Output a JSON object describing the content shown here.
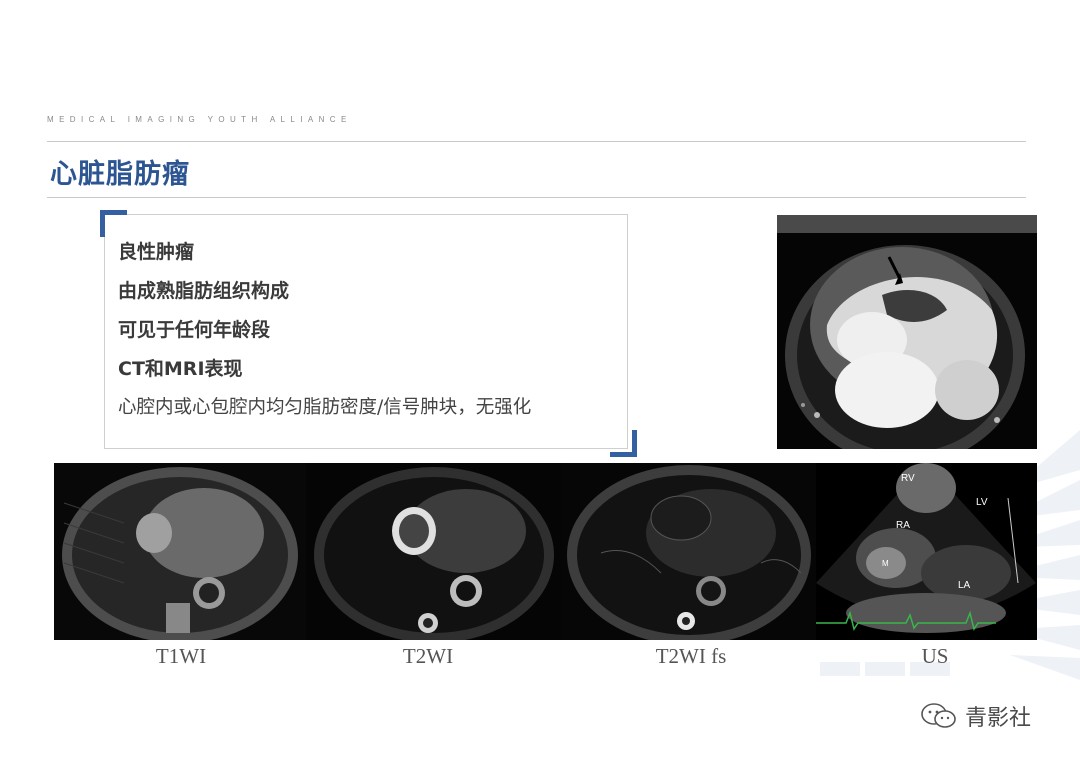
{
  "header": {
    "org_line": "MEDICAL IMAGING YOUTH ALLIANCE",
    "title": "心脏脂肪瘤"
  },
  "bullets": [
    {
      "text": "良性肿瘤",
      "bold": true
    },
    {
      "text": "由成熟脂肪组织构成",
      "bold": true
    },
    {
      "text": "可见于任何年龄段",
      "bold": true
    },
    {
      "text": "CT和MRI表现",
      "bold": true
    },
    {
      "text": "心腔内或心包腔内均匀脂肪密度/信号肿块，无强化",
      "bold": false
    }
  ],
  "images": {
    "ct": {
      "name": "ct-image"
    },
    "us_labels": {
      "rv": "RV",
      "lv": "LV",
      "ra": "RA",
      "la": "LA",
      "m": "M"
    }
  },
  "captions": [
    "T1WI",
    "T2WI",
    "T2WI fs",
    "US"
  ],
  "watermark": {
    "text": "青影社"
  },
  "colors": {
    "title": "#2c5592",
    "accent": "#3460a2"
  }
}
